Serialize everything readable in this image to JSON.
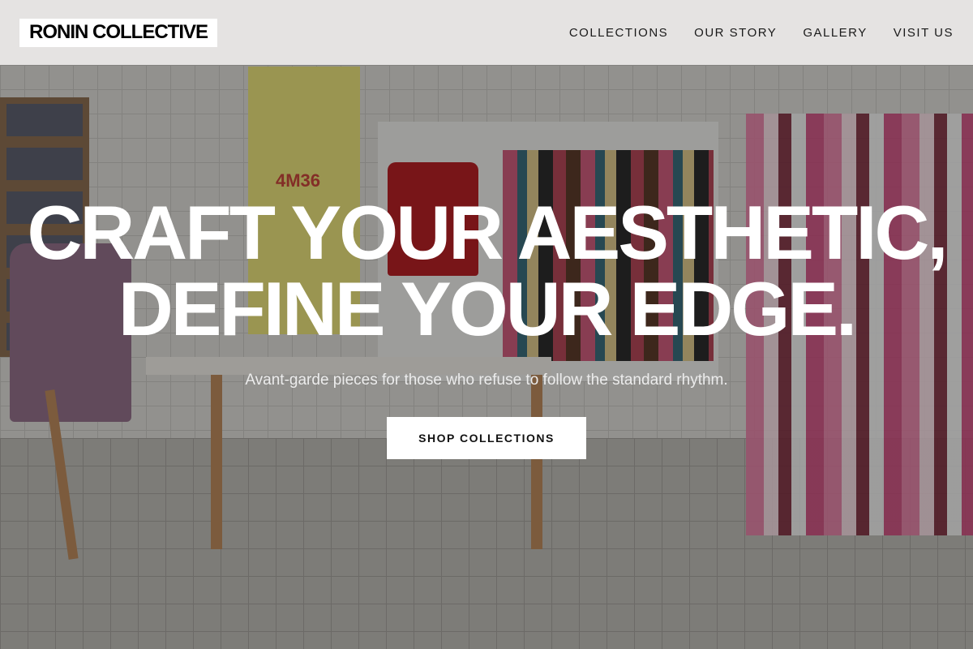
{
  "brand": {
    "logo_text": "RONIN COLLECTIVE"
  },
  "nav": {
    "items": [
      {
        "label": "COLLECTIONS"
      },
      {
        "label": "OUR STORY"
      },
      {
        "label": "GALLERY"
      },
      {
        "label": "VISIT US"
      }
    ]
  },
  "hero": {
    "headline_line1": "CRAFT YOUR AESTHETIC,",
    "headline_line2": "DEFINE YOUR EDGE.",
    "subtitle": "Avant-garde pieces for those who refuse to follow the standard rhythm.",
    "cta_label": "SHOP COLLECTIONS",
    "background_description_icon": "clothing-store-photo"
  },
  "colors": {
    "header_bg": "#eceae8",
    "logo_bg": "#ffffff",
    "cta_bg": "#ffffff",
    "text_light": "#ffffff"
  }
}
